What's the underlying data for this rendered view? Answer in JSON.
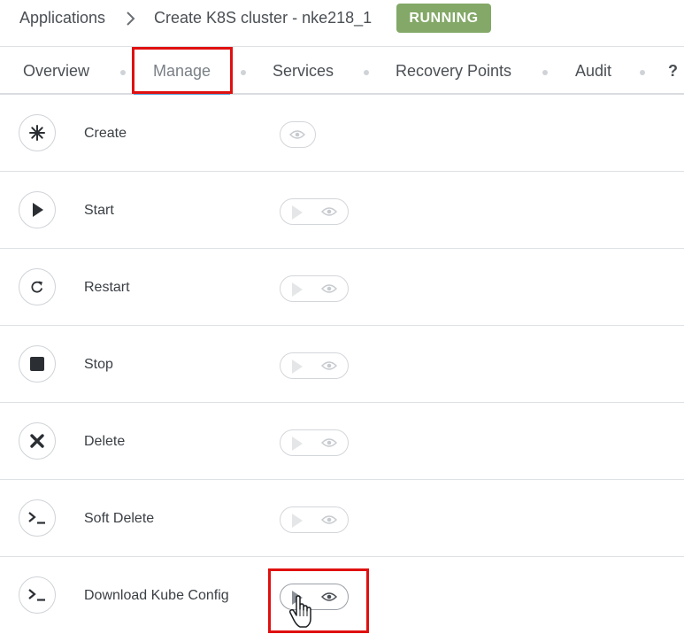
{
  "breadcrumb": {
    "root": "Applications",
    "current": "Create K8S cluster - nke218_1",
    "status": "RUNNING"
  },
  "colors": {
    "status_badge": "#83a867",
    "highlight": "#e01010",
    "active_tab_underline": "#5b9bd5"
  },
  "tabs": [
    {
      "label": "Overview",
      "active": false
    },
    {
      "label": "Manage",
      "active": true
    },
    {
      "label": "Services",
      "active": false
    },
    {
      "label": "Recovery Points",
      "active": false
    },
    {
      "label": "Audit",
      "active": false
    },
    {
      "label": "?",
      "active": false
    }
  ],
  "actions": [
    {
      "label": "Create",
      "icon": "asterisk-icon",
      "run_button": false
    },
    {
      "label": "Start",
      "icon": "play-icon",
      "run_button": true
    },
    {
      "label": "Restart",
      "icon": "restart-icon",
      "run_button": true
    },
    {
      "label": "Stop",
      "icon": "stop-icon",
      "run_button": true
    },
    {
      "label": "Delete",
      "icon": "x-icon",
      "run_button": true
    },
    {
      "label": "Soft Delete",
      "icon": "terminal-icon",
      "run_button": true
    },
    {
      "label": "Download Kube Config",
      "icon": "terminal-icon",
      "run_button": true
    }
  ]
}
